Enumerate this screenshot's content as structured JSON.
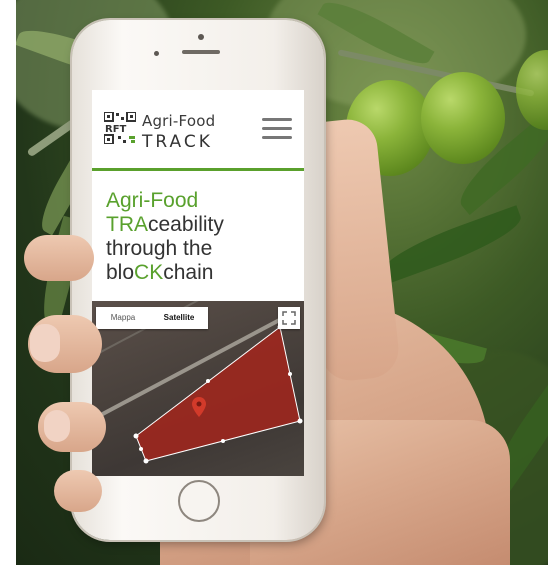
{
  "app": {
    "logo_line1": "Agri-Food",
    "logo_line2": "TRACK"
  },
  "hero": {
    "line1_green": "Agri-Food",
    "line2_green": "TRA",
    "line2_rest": "ceability",
    "line3": "through the",
    "line4_a": "blo",
    "line4_green": "CK",
    "line4_b": "chain"
  },
  "map": {
    "tabs": [
      {
        "label": "Mappa",
        "active": false
      },
      {
        "label": "Satellite",
        "active": true
      }
    ]
  },
  "colors": {
    "accent_green": "#59a12d",
    "field_red": "#a3261c"
  },
  "icons": [
    "qr-code-icon",
    "menu-icon",
    "fullscreen-icon",
    "location-pin-icon"
  ]
}
